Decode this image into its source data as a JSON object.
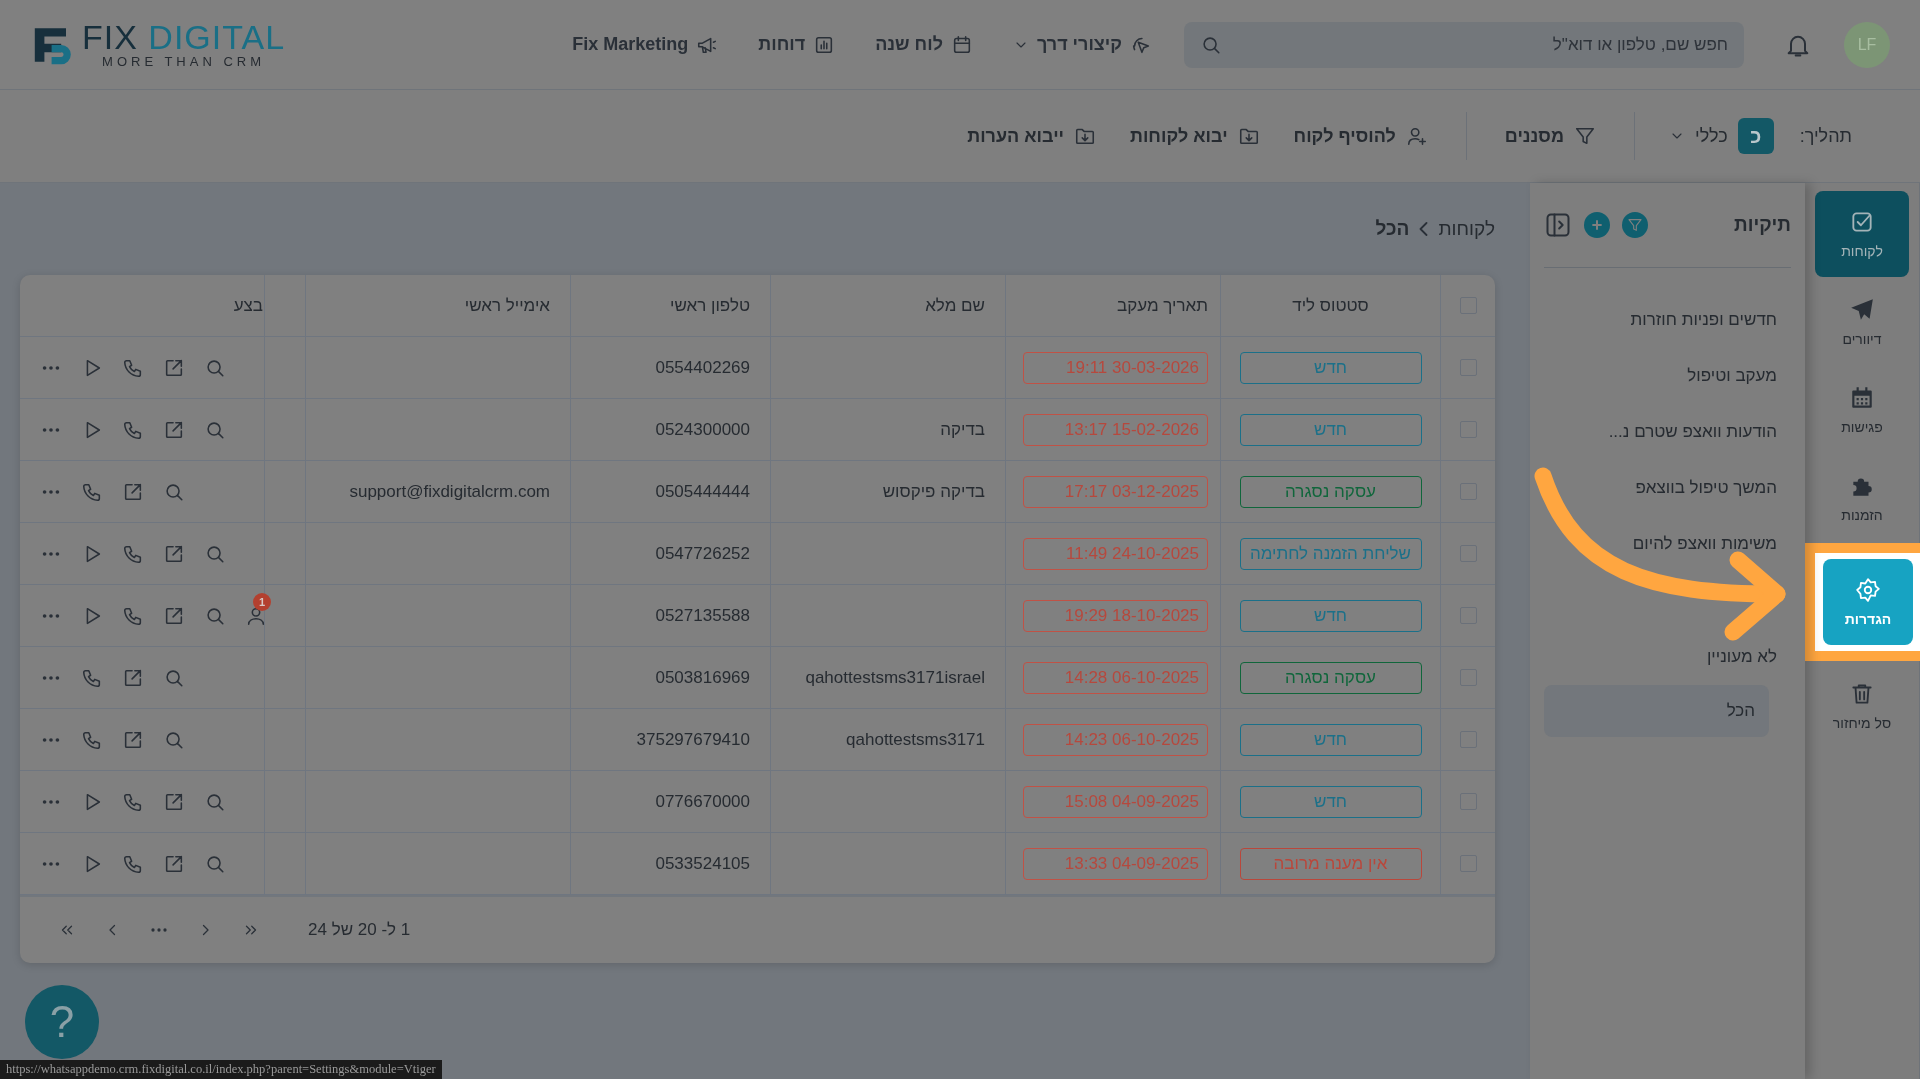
{
  "header": {
    "logo": {
      "word1": "FIX",
      "word2": "DIGITAL",
      "tagline": "MORE THAN CRM"
    },
    "search": {
      "placeholder": "חפש שם, טלפון או דוא\"ל"
    },
    "avatar": {
      "initials": "LF"
    },
    "nav": [
      {
        "label": "קיצורי דרך",
        "dropdown": true
      },
      {
        "label": "לוח שנה",
        "dropdown": false
      },
      {
        "label": "דוחות",
        "dropdown": false
      },
      {
        "label": "Fix Marketing",
        "dropdown": false
      }
    ]
  },
  "toolbar": {
    "process_label": "תהליך:",
    "process": {
      "badge": "כ",
      "value": "כללי"
    },
    "filters": "מסננים",
    "actions": [
      "להוסיף לקוח",
      "יבוא לקוחות",
      "ייבוא הערות"
    ]
  },
  "rail": [
    {
      "label": "לקוחות",
      "selected": true,
      "highlighted": false
    },
    {
      "label": "דיוורים",
      "selected": false,
      "highlighted": false
    },
    {
      "label": "פגישות",
      "selected": false,
      "highlighted": false
    },
    {
      "label": "הזמנות",
      "selected": false,
      "highlighted": false
    },
    {
      "label": "הגדרות",
      "selected": false,
      "highlighted": true
    },
    {
      "label": "סל מיחזור",
      "selected": false,
      "highlighted": false
    }
  ],
  "folders": {
    "title": "תיקיות",
    "items": [
      {
        "label": "חדשים ופניות חוזרות",
        "selected": false
      },
      {
        "label": "מעקב וטיפול",
        "selected": false
      },
      {
        "label": "הודעות וואצפ שטרם נ...",
        "selected": false
      },
      {
        "label": "המשך טיפול בווצאפ",
        "selected": false
      },
      {
        "label": "משימות וואצפ להיום",
        "selected": false
      },
      {
        "label": "לא מעוניין",
        "selected": false
      },
      {
        "label": "הכל",
        "selected": true
      }
    ]
  },
  "breadcrumb": [
    "לקוחות",
    "הכל"
  ],
  "table": {
    "all_checked": false,
    "columns": [
      "סטטוס ליד",
      "תאריך מעקב",
      "שם מלא",
      "טלפון ראשי",
      "אימייל ראשי",
      "בצע"
    ],
    "rows": [
      {
        "checked": false,
        "status": {
          "text": "חדש",
          "color": "#1b7089"
        },
        "date": "19:11 30-03-2026",
        "name": "",
        "phone": "0554402269",
        "email": "",
        "actions": [
          {
            "kind": "search"
          },
          {
            "kind": "open"
          },
          {
            "kind": "call"
          },
          {
            "kind": "play"
          },
          {
            "kind": "more"
          }
        ]
      },
      {
        "checked": false,
        "status": {
          "text": "חדש",
          "color": "#1b7089"
        },
        "date": "13:17 15-02-2026",
        "name": "בדיקה",
        "phone": "0524300000",
        "email": "",
        "actions": [
          {
            "kind": "search"
          },
          {
            "kind": "open"
          },
          {
            "kind": "call"
          },
          {
            "kind": "play"
          },
          {
            "kind": "more"
          }
        ]
      },
      {
        "checked": false,
        "status": {
          "text": "עסקה נסגרה",
          "color": "#10663b"
        },
        "date": "17:17 03-12-2025",
        "name": "בדיקה פיקסוש",
        "phone": "0505444444",
        "email": "support@fixdigitalcrm.com",
        "actions": [
          {
            "kind": "search"
          },
          {
            "kind": "open"
          },
          {
            "kind": "call"
          },
          {
            "kind": "more"
          }
        ]
      },
      {
        "checked": false,
        "status": {
          "text": "שליחת הזמנה לחתימה",
          "color": "#1b7089"
        },
        "date": "11:49 24-10-2025",
        "name": "",
        "phone": "0547726252",
        "email": "",
        "actions": [
          {
            "kind": "search"
          },
          {
            "kind": "open"
          },
          {
            "kind": "call"
          },
          {
            "kind": "play"
          },
          {
            "kind": "more"
          }
        ]
      },
      {
        "checked": false,
        "status": {
          "text": "חדש",
          "color": "#1b7089"
        },
        "date": "19:29 18-10-2025",
        "name": "",
        "phone": "0527135588",
        "email": "",
        "badge": "1",
        "actions": [
          {
            "kind": "person"
          },
          {
            "kind": "search"
          },
          {
            "kind": "open"
          },
          {
            "kind": "call"
          },
          {
            "kind": "play"
          },
          {
            "kind": "more"
          }
        ]
      },
      {
        "checked": false,
        "status": {
          "text": "עסקה נסגרה",
          "color": "#10663b"
        },
        "date": "14:28 06-10-2025",
        "name": "qahottestsms3171israel",
        "phone": "0503816969",
        "email": "",
        "actions": [
          {
            "kind": "search"
          },
          {
            "kind": "open"
          },
          {
            "kind": "call"
          },
          {
            "kind": "more"
          }
        ]
      },
      {
        "checked": false,
        "status": {
          "text": "חדש",
          "color": "#1b7089"
        },
        "date": "14:23 06-10-2025",
        "name": "qahottestsms3171",
        "phone": "375297679410",
        "email": "",
        "actions": [
          {
            "kind": "search"
          },
          {
            "kind": "open"
          },
          {
            "kind": "call"
          },
          {
            "kind": "more"
          }
        ]
      },
      {
        "checked": false,
        "status": {
          "text": "חדש",
          "color": "#1b7089"
        },
        "date": "15:08 04-09-2025",
        "name": "",
        "phone": "0776670000",
        "email": "",
        "actions": [
          {
            "kind": "search"
          },
          {
            "kind": "open"
          },
          {
            "kind": "call"
          },
          {
            "kind": "play"
          },
          {
            "kind": "more"
          }
        ]
      },
      {
        "checked": false,
        "status": {
          "text": "אין מענה מרובה",
          "color": "#b9473b"
        },
        "date": "13:33 04-09-2025",
        "name": "",
        "phone": "0533524105",
        "email": "",
        "actions": [
          {
            "kind": "search"
          },
          {
            "kind": "open"
          },
          {
            "kind": "call"
          },
          {
            "kind": "play"
          },
          {
            "kind": "more"
          }
        ]
      }
    ]
  },
  "pagination": {
    "range": "1 ל- 20 של 24"
  },
  "help": "?",
  "status_url": "https://whatsappdemo.crm.fixdigital.co.il/index.php?parent=Settings&module=Vtiger"
}
